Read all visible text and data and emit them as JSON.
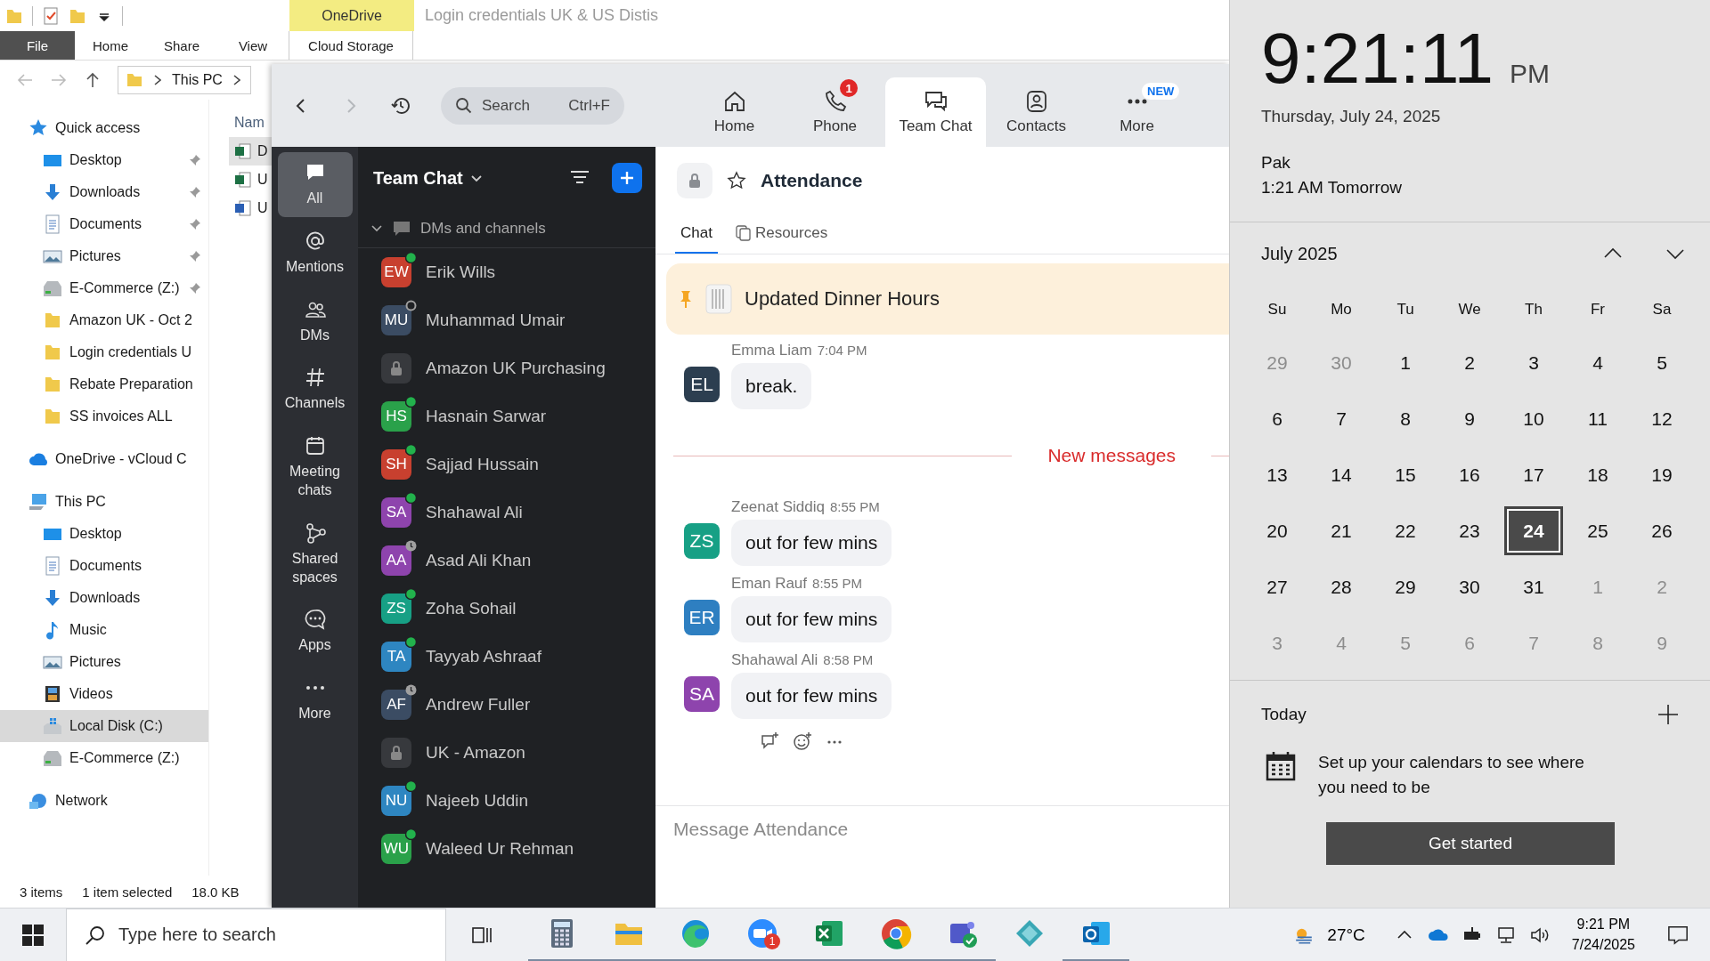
{
  "explorer": {
    "contextual_tab": "OneDrive",
    "title": "Login credentials UK & US Distis",
    "ribbon_tabs": [
      {
        "label": "File",
        "kind": "file"
      },
      {
        "label": "Home",
        "kind": "tab"
      },
      {
        "label": "Share",
        "kind": "tab"
      },
      {
        "label": "View",
        "kind": "tab"
      },
      {
        "label": "Cloud Storage",
        "kind": "contextual"
      }
    ],
    "address": "This PC",
    "nav": [
      {
        "label": "Quick access",
        "kind": "star",
        "selected": false,
        "children": [
          {
            "label": "Desktop",
            "kind": "desktop",
            "pinned": true,
            "selected": false
          },
          {
            "label": "Downloads",
            "kind": "downloads",
            "pinned": true,
            "selected": false
          },
          {
            "label": "Documents",
            "kind": "documents",
            "pinned": true,
            "selected": false
          },
          {
            "label": "Pictures",
            "kind": "pictures",
            "pinned": true,
            "selected": false
          },
          {
            "label": "E-Commerce (Z:)",
            "kind": "drive",
            "pinned": true,
            "selected": false
          },
          {
            "label": "Amazon UK - Oct 2",
            "kind": "folder",
            "pinned": false,
            "selected": false
          },
          {
            "label": "Login credentials U",
            "kind": "folder",
            "pinned": false,
            "selected": false
          },
          {
            "label": "Rebate Preparation",
            "kind": "folder",
            "pinned": false,
            "selected": false
          },
          {
            "label": "SS invoices ALL",
            "kind": "folder",
            "pinned": false,
            "selected": false
          }
        ]
      },
      {
        "label": "OneDrive - vCloud C",
        "kind": "cloud",
        "selected": false
      },
      {
        "label": "This PC",
        "kind": "pc",
        "selected": false,
        "children": [
          {
            "label": "Desktop",
            "kind": "desktop",
            "selected": false
          },
          {
            "label": "Documents",
            "kind": "documents",
            "selected": false
          },
          {
            "label": "Downloads",
            "kind": "downloads",
            "selected": false
          },
          {
            "label": "Music",
            "kind": "music",
            "selected": false
          },
          {
            "label": "Pictures",
            "kind": "pictures",
            "selected": false
          },
          {
            "label": "Videos",
            "kind": "videos",
            "selected": false
          },
          {
            "label": "Local Disk (C:)",
            "kind": "disk",
            "selected": true
          },
          {
            "label": "E-Commerce (Z:)",
            "kind": "drive",
            "selected": false
          }
        ]
      },
      {
        "label": "Network",
        "kind": "network",
        "selected": false
      }
    ],
    "column_header": "Nam",
    "files": [
      {
        "kind": "excel",
        "name": "D",
        "selected": true
      },
      {
        "kind": "excel",
        "name": "U",
        "selected": false
      },
      {
        "kind": "word",
        "name": "U",
        "selected": false
      }
    ],
    "status": [
      "3 items",
      "1 item selected",
      "18.0 KB"
    ]
  },
  "zoom": {
    "search": {
      "placeholder": "Search",
      "shortcut": "Ctrl+F"
    },
    "tabs": [
      {
        "label": "Home",
        "kind": "home",
        "selected": false
      },
      {
        "label": "Phone",
        "kind": "phone",
        "selected": false,
        "badge": "1"
      },
      {
        "label": "Team Chat",
        "kind": "chat",
        "selected": true
      },
      {
        "label": "Contacts",
        "kind": "contacts",
        "selected": false
      },
      {
        "label": "More",
        "kind": "more",
        "selected": false,
        "tag": "NEW"
      }
    ],
    "rail": [
      {
        "label": "All",
        "kind": "all",
        "selected": true
      },
      {
        "label": "Mentions",
        "kind": "mentions",
        "selected": false
      },
      {
        "label": "DMs",
        "kind": "dms",
        "selected": false
      },
      {
        "label": "Channels",
        "kind": "channels",
        "selected": false
      },
      {
        "label": "Meeting chats",
        "kind": "meetings",
        "selected": false
      },
      {
        "label": "Shared spaces",
        "kind": "shared",
        "selected": false
      },
      {
        "label": "Apps",
        "kind": "apps",
        "selected": false
      },
      {
        "label": "More",
        "kind": "more",
        "selected": false
      }
    ],
    "list_title": "Team Chat",
    "section": "DMs and channels",
    "contacts": [
      {
        "name": "Erik Wills",
        "kind": "dm",
        "initials": "EW",
        "color": "#c8402f",
        "online": true,
        "away": false
      },
      {
        "name": "Muhammad Umair",
        "kind": "dm",
        "initials": "MU",
        "color": "#3b4c63",
        "online": false,
        "away": false
      },
      {
        "name": "Amazon UK Purchasing",
        "kind": "channel"
      },
      {
        "name": "Hasnain Sarwar",
        "kind": "dm",
        "initials": "HS",
        "color": "#2aa14a",
        "online": true,
        "away": false
      },
      {
        "name": "Sajjad Hussain",
        "kind": "dm",
        "initials": "SH",
        "color": "#c8402f",
        "online": true,
        "away": false
      },
      {
        "name": "Shahawal Ali",
        "kind": "dm",
        "initials": "SA",
        "color": "#8e44ad",
        "online": true,
        "away": false
      },
      {
        "name": "Asad Ali Khan",
        "kind": "dm",
        "initials": "AA",
        "color": "#8e44ad",
        "online": false,
        "away": true
      },
      {
        "name": "Zoha Sohail",
        "kind": "dm",
        "initials": "ZS",
        "color": "#17a085",
        "online": true,
        "away": false
      },
      {
        "name": "Tayyab Ashraaf",
        "kind": "dm",
        "initials": "TA",
        "color": "#2e86c1",
        "online": true,
        "away": false
      },
      {
        "name": "Andrew Fuller",
        "kind": "dm",
        "initials": "AF",
        "color": "#3b4c63",
        "online": false,
        "away": true
      },
      {
        "name": "UK - Amazon",
        "kind": "channel"
      },
      {
        "name": "Najeeb Uddin",
        "kind": "dm",
        "initials": "NU",
        "color": "#2e86c1",
        "online": true,
        "away": false
      },
      {
        "name": "Waleed Ur Rehman",
        "kind": "dm",
        "initials": "WU",
        "color": "#2aa14a",
        "online": true,
        "away": false
      }
    ],
    "channel": {
      "title": "Attendance",
      "tabs": [
        {
          "label": "Chat",
          "kind": "chat",
          "selected": true
        },
        {
          "label": "Resources",
          "kind": "resources",
          "selected": false
        }
      ],
      "pinned": "Updated Dinner Hours",
      "messages": [
        {
          "kind": "message",
          "sender": "Emma Liam",
          "time": "7:04 PM",
          "initials": "EL",
          "color": "#2c3e50",
          "text": "break."
        },
        {
          "kind": "divider",
          "text": "New messages"
        },
        {
          "kind": "message",
          "sender": "Zeenat Siddiq",
          "time": "8:55 PM",
          "initials": "ZS",
          "color": "#17a085",
          "text": "out for few mins"
        },
        {
          "kind": "message",
          "sender": "Eman Rauf",
          "time": "8:55 PM",
          "initials": "ER",
          "color": "#2e7fc1",
          "text": "out for few mins"
        },
        {
          "kind": "message",
          "sender": "Shahawal Ali",
          "time": "8:58 PM",
          "initials": "SA",
          "color": "#8e44ad",
          "text": "out for few mins"
        }
      ],
      "composer": {
        "placeholder": "Message Attendance"
      }
    }
  },
  "clock_panel": {
    "time": "9:21:11",
    "ampm": "PM",
    "date": "Thursday, July 24, 2025",
    "zone": "Pak",
    "zone_time": "1:21 AM Tomorrow",
    "month": "July 2025",
    "weekdays": [
      "Su",
      "Mo",
      "Tu",
      "We",
      "Th",
      "Fr",
      "Sa"
    ],
    "weeks": [
      [
        {
          "label": "29",
          "in_month": false,
          "selected": false
        },
        {
          "label": "30",
          "in_month": false,
          "selected": false
        },
        {
          "label": "1",
          "in_month": true,
          "selected": false
        },
        {
          "label": "2",
          "in_month": true,
          "selected": false
        },
        {
          "label": "3",
          "in_month": true,
          "selected": false
        },
        {
          "label": "4",
          "in_month": true,
          "selected": false
        },
        {
          "label": "5",
          "in_month": true,
          "selected": false
        }
      ],
      [
        {
          "label": "6",
          "in_month": true,
          "selected": false
        },
        {
          "label": "7",
          "in_month": true,
          "selected": false
        },
        {
          "label": "8",
          "in_month": true,
          "selected": false
        },
        {
          "label": "9",
          "in_month": true,
          "selected": false
        },
        {
          "label": "10",
          "in_month": true,
          "selected": false
        },
        {
          "label": "11",
          "in_month": true,
          "selected": false
        },
        {
          "label": "12",
          "in_month": true,
          "selected": false
        }
      ],
      [
        {
          "label": "13",
          "in_month": true,
          "selected": false
        },
        {
          "label": "14",
          "in_month": true,
          "selected": false
        },
        {
          "label": "15",
          "in_month": true,
          "selected": false
        },
        {
          "label": "16",
          "in_month": true,
          "selected": false
        },
        {
          "label": "17",
          "in_month": true,
          "selected": false
        },
        {
          "label": "18",
          "in_month": true,
          "selected": false
        },
        {
          "label": "19",
          "in_month": true,
          "selected": false
        }
      ],
      [
        {
          "label": "20",
          "in_month": true,
          "selected": false
        },
        {
          "label": "21",
          "in_month": true,
          "selected": false
        },
        {
          "label": "22",
          "in_month": true,
          "selected": false
        },
        {
          "label": "23",
          "in_month": true,
          "selected": false
        },
        {
          "label": "24",
          "in_month": true,
          "selected": true
        },
        {
          "label": "25",
          "in_month": true,
          "selected": false
        },
        {
          "label": "26",
          "in_month": true,
          "selected": false
        }
      ],
      [
        {
          "label": "27",
          "in_month": true,
          "selected": false
        },
        {
          "label": "28",
          "in_month": true,
          "selected": false
        },
        {
          "label": "29",
          "in_month": true,
          "selected": false
        },
        {
          "label": "30",
          "in_month": true,
          "selected": false
        },
        {
          "label": "31",
          "in_month": true,
          "selected": false
        },
        {
          "label": "1",
          "in_month": false,
          "selected": false
        },
        {
          "label": "2",
          "in_month": false,
          "selected": false
        }
      ],
      [
        {
          "label": "3",
          "in_month": false,
          "selected": false
        },
        {
          "label": "4",
          "in_month": false,
          "selected": false
        },
        {
          "label": "5",
          "in_month": false,
          "selected": false
        },
        {
          "label": "6",
          "in_month": false,
          "selected": false
        },
        {
          "label": "7",
          "in_month": false,
          "selected": false
        },
        {
          "label": "8",
          "in_month": false,
          "selected": false
        },
        {
          "label": "9",
          "in_month": false,
          "selected": false
        }
      ]
    ],
    "today": "Today",
    "agenda": "Set up your calendars to see where you need to be",
    "button": "Get started"
  },
  "taskbar": {
    "search": {
      "placeholder": "Type here to search"
    },
    "apps": [
      {
        "kind": "calculator",
        "running": true
      },
      {
        "kind": "explorer",
        "running": true
      },
      {
        "kind": "edge",
        "running": true
      },
      {
        "kind": "zoom",
        "running": true,
        "badge": "1"
      },
      {
        "kind": "excel",
        "running": true
      },
      {
        "kind": "chrome",
        "running": true
      },
      {
        "kind": "teams",
        "running": true
      },
      {
        "kind": "diamond",
        "running": false
      },
      {
        "kind": "outlook",
        "running": true
      }
    ],
    "weather": "27°C",
    "time": "9:21 PM",
    "date": "7/24/2025"
  }
}
